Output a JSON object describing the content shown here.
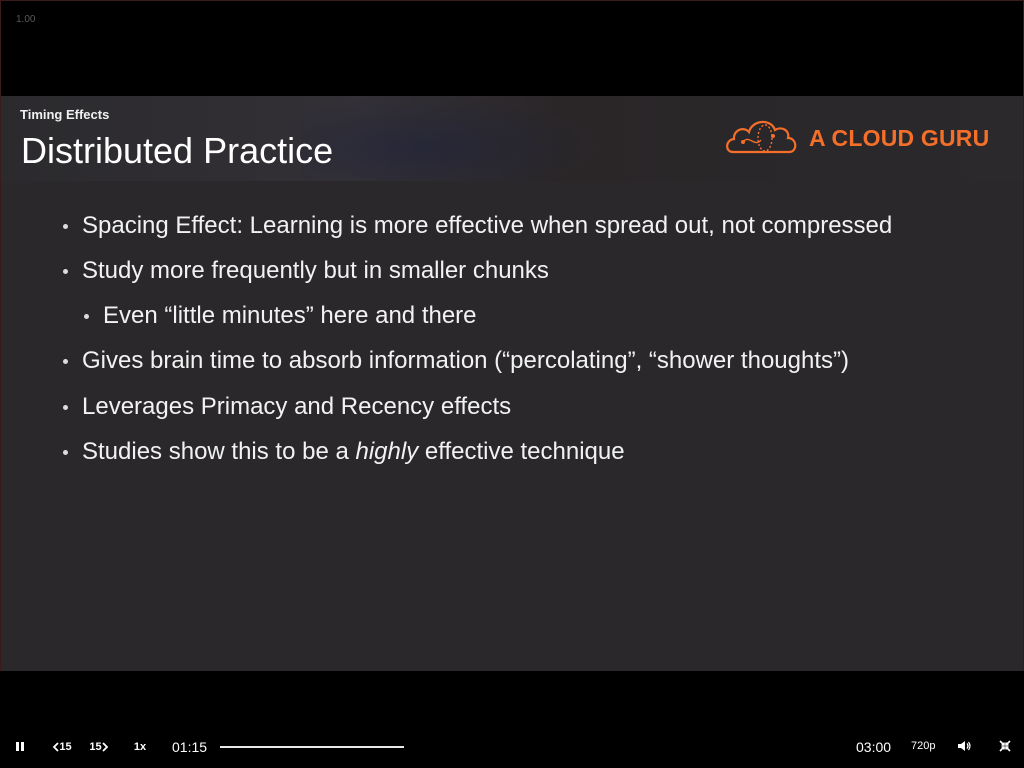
{
  "player": {
    "zoom_label": "1.00",
    "current_time": "01:15",
    "duration": "03:00",
    "progress_fraction": 0.42,
    "speed_label": "1x",
    "rewind_label": "15",
    "forward_label": "15",
    "quality_label": "720p"
  },
  "slide": {
    "section": "Timing Effects",
    "title": "Distributed Practice",
    "brand": "A CLOUD GURU",
    "bullets": [
      {
        "text": "Spacing Effect: Learning is more effective when spread out, not compressed"
      },
      {
        "text": "Study more frequently but in smaller chunks"
      },
      {
        "text": "Even “little minutes” here and there"
      },
      {
        "text": "Gives brain time to absorb information (“percolating”, “shower thoughts”)"
      },
      {
        "text": "Leverages Primacy and Recency effects"
      },
      {
        "pre": "Studies show this to be a ",
        "em": "highly",
        "post": " effective technique"
      }
    ]
  },
  "colors": {
    "brand_orange": "#f36f2a",
    "slide_background": "#2a282b",
    "player_background": "#000000"
  },
  "icons": {
    "play_pause": "pause-icon",
    "rewind": "rewind-15-icon",
    "forward": "forward-15-icon",
    "volume": "volume-icon",
    "exit_fullscreen": "exit-fullscreen-icon",
    "brand_logo": "cloud-logo-icon"
  }
}
